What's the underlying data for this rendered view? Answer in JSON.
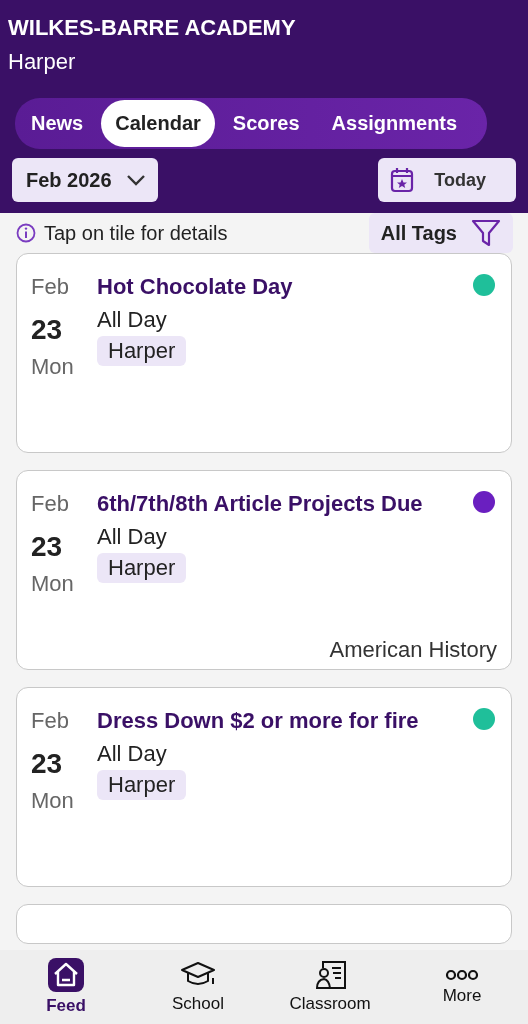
{
  "header": {
    "school": "WILKES-BARRE ACADEMY",
    "student": "Harper"
  },
  "tabs": [
    {
      "label": "News",
      "selected": false
    },
    {
      "label": "Calendar",
      "selected": true
    },
    {
      "label": "Scores",
      "selected": false
    },
    {
      "label": "Assignments",
      "selected": false
    }
  ],
  "month_picker": {
    "value": "Feb 2026"
  },
  "today_button": {
    "label": "Today"
  },
  "hint": "Tap on tile for details",
  "tag_filter": {
    "label": "All Tags"
  },
  "events": [
    {
      "month": "Feb",
      "day": "23",
      "weekday": "Mon",
      "title": "Hot Chocolate Day",
      "time": "All Day",
      "tag": "Harper",
      "color": "#1fbf9a"
    },
    {
      "month": "Feb",
      "day": "23",
      "weekday": "Mon",
      "title": "6th/7th/8th Article Projects Due",
      "time": "All Day",
      "tag": "Harper",
      "color": "#6a1fc0",
      "subject": "American History"
    },
    {
      "month": "Feb",
      "day": "23",
      "weekday": "Mon",
      "title": "Dress Down $2 or more for fire",
      "time": "All Day",
      "tag": "Harper",
      "color": "#1fbf9a"
    }
  ],
  "nav": [
    {
      "label": "Feed",
      "kind": "feed",
      "selected": true
    },
    {
      "label": "School",
      "kind": "school",
      "selected": false
    },
    {
      "label": "Classroom",
      "kind": "classroom",
      "selected": false
    },
    {
      "label": "More",
      "kind": "more",
      "selected": false
    }
  ]
}
